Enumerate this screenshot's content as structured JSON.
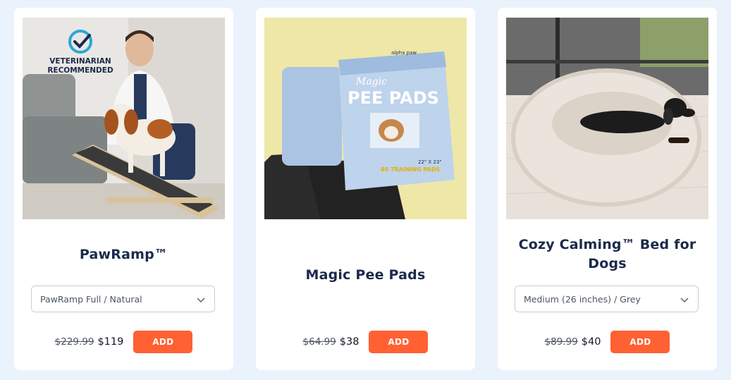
{
  "products": [
    {
      "image_alt": "PawRamp with veterinarian and dog",
      "badge_line1": "VETERINARIAN",
      "badge_line2": "RECOMMENDED",
      "title": "PawRamp™",
      "variant": "PawRamp Full / Natural",
      "compare_price": "$229.99",
      "price": "$119",
      "button": "ADD"
    },
    {
      "image_alt": "Magic Pee Pads package",
      "package_brand": "alpha paw",
      "package_line1": "Magic",
      "package_line2": "PEE PADS",
      "package_size": "22\" X 23\"",
      "package_count": "80 TRAINING PADS",
      "title": "Magic Pee Pads",
      "compare_price": "$64.99",
      "price": "$38",
      "button": "ADD"
    },
    {
      "image_alt": "Dog in fluffy calming bed",
      "title": "Cozy Calming™ Bed for Dogs",
      "variant": "Medium (26 inches) / Grey",
      "compare_price": "$89.99",
      "price": "$40",
      "button": "ADD"
    }
  ],
  "colors": {
    "background": "#eaf3fb",
    "card": "#ffffff",
    "title": "#1b2a4a",
    "button": "#ff6133",
    "badge_check": "#2aa7d8"
  }
}
